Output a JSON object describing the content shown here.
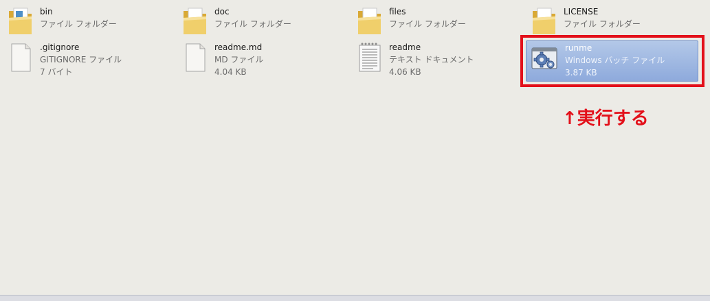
{
  "files": [
    {
      "name": "bin",
      "type": "ファイル フォルダー",
      "size": "",
      "icon": "folder-icon"
    },
    {
      "name": "doc",
      "type": "ファイル フォルダー",
      "size": "",
      "icon": "folder-icon"
    },
    {
      "name": "files",
      "type": "ファイル フォルダー",
      "size": "",
      "icon": "folder-icon"
    },
    {
      "name": "LICENSE",
      "type": "ファイル フォルダー",
      "size": "",
      "icon": "folder-icon"
    },
    {
      "name": ".gitignore",
      "type": "GITIGNORE ファイル",
      "size": "7 バイト",
      "icon": "blank-file-icon"
    },
    {
      "name": "readme.md",
      "type": "MD ファイル",
      "size": "4.04 KB",
      "icon": "blank-file-icon"
    },
    {
      "name": "readme",
      "type": "テキスト ドキュメント",
      "size": "4.06 KB",
      "icon": "text-document-icon"
    },
    {
      "name": "runme",
      "type": "Windows バッチ ファイル",
      "size": "3.87 KB",
      "icon": "batch-file-gear-icon",
      "selected": true
    }
  ],
  "annotation": {
    "text": "↑実行する",
    "color": "#e3101a"
  },
  "colors": {
    "background": "#ecebe6",
    "selection": "#8eaadc",
    "highlight": "#e3101a",
    "folder": "#e8c35a"
  }
}
